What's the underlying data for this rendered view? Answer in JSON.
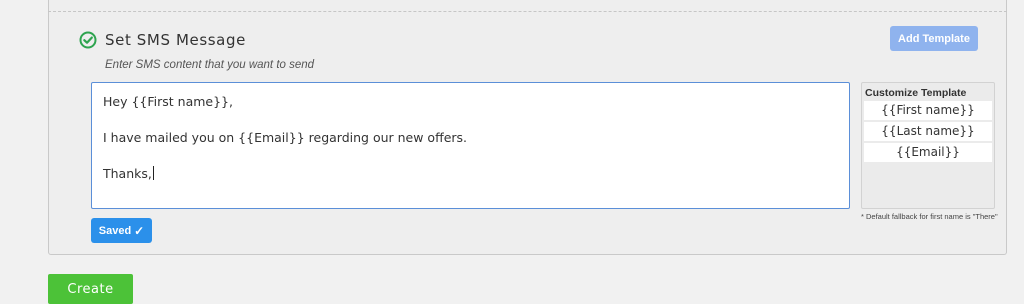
{
  "sms_section": {
    "title": "Set SMS Message",
    "subtitle": "Enter SMS content that you want to send",
    "add_template_label": "Add Template",
    "message_lines": [
      "Hey {{First name}},",
      "I have mailed you on {{Email}} regarding our new offers.",
      "Thanks,"
    ],
    "saved_label": "Saved",
    "saved_icon": "checkmark-icon",
    "status_icon": "check-circle-icon",
    "accent_color": "#2b90ea",
    "success_color": "#2ea44f"
  },
  "template_panel": {
    "title": "Customize Template",
    "items": [
      "{{First name}}",
      "{{Last name}}",
      "{{Email}}"
    ],
    "fallback_note": "* Default fallback for first name is \"There\""
  },
  "footer": {
    "create_label": "Create",
    "create_color": "#4cc238"
  }
}
